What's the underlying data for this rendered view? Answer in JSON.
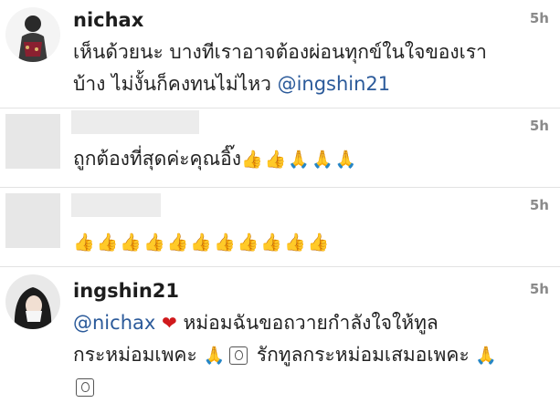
{
  "comments": [
    {
      "username": "nichax",
      "time": "5h",
      "line1": "เห็นด้วยนะ บางทีเราอาจต้องผ่อนทุกข์ในใจของเรา",
      "line2_prefix": "บ้าง ไม่งั้นก็คงทนไม่ไหว ",
      "mention": "@ingshin21",
      "avatar_icon": "user-avatar-icon"
    },
    {
      "username": "",
      "time": "5h",
      "text": "ถูกต้องที่สุดค่ะคุณอิ๊ง",
      "emojis": [
        "thumbs-up",
        "thumbs-up",
        "folded-hands",
        "folded-hands",
        "folded-hands"
      ],
      "avatar_icon": "blank-avatar-icon"
    },
    {
      "username": "",
      "time": "5h",
      "emojis": [
        "thumbs-up",
        "thumbs-up",
        "thumbs-up",
        "thumbs-up",
        "thumbs-up",
        "thumbs-up",
        "thumbs-up",
        "thumbs-up",
        "thumbs-up",
        "thumbs-up",
        "thumbs-up"
      ],
      "avatar_icon": "blank-avatar-icon"
    },
    {
      "username": "ingshin21",
      "time": "5h",
      "mention": "@nichax",
      "line1_text": "หม่อมฉันขอถวายกำลังใจให้ทูล",
      "line2_a": "กระหม่อมเพคะ",
      "line2_b": "รักทูลกระหม่อมเสมอเพคะ",
      "avatar_icon": "user-avatar-icon"
    }
  ],
  "colors": {
    "mention": "#2b5a9a",
    "time": "#8a8a8a",
    "heart": "#d0191c"
  }
}
